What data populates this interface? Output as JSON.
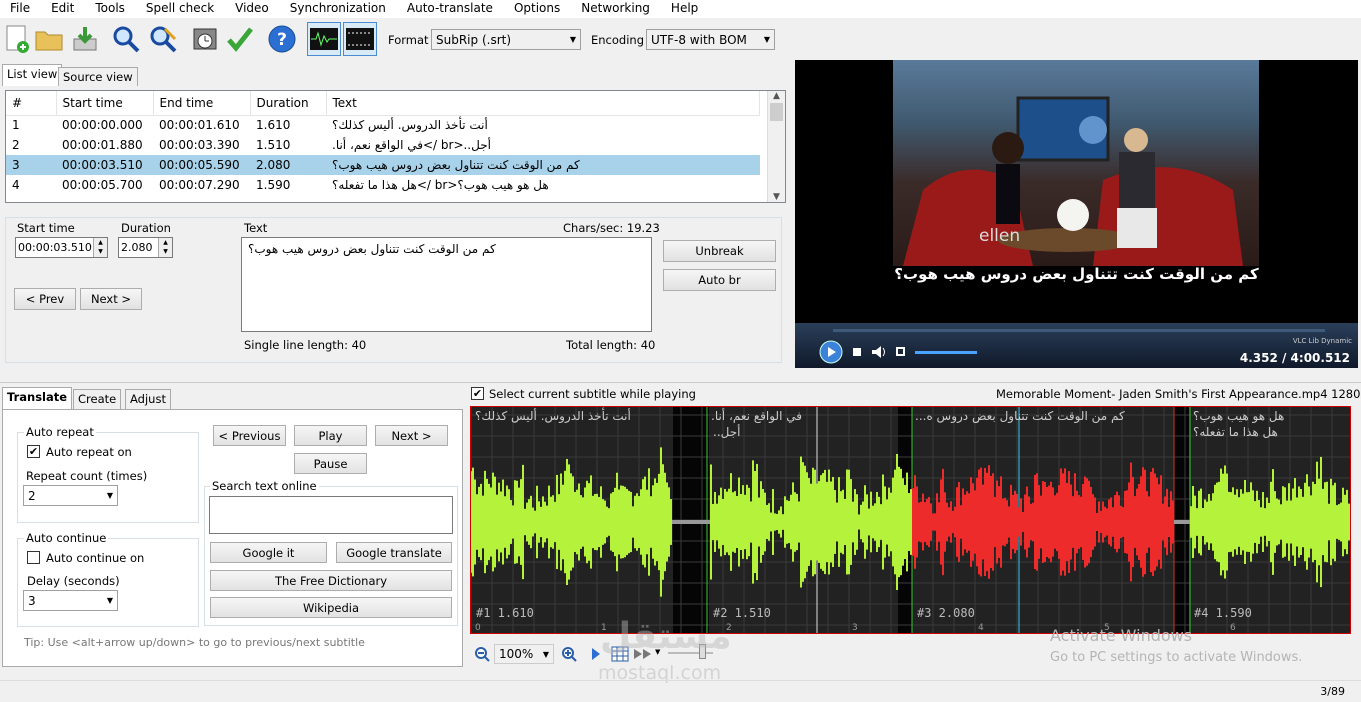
{
  "menu": [
    "File",
    "Edit",
    "Tools",
    "Spell check",
    "Video",
    "Synchronization",
    "Auto-translate",
    "Options",
    "Networking",
    "Help"
  ],
  "toolbar": {
    "format_label": "Format",
    "format_value": "SubRip (.srt)",
    "encoding_label": "Encoding",
    "encoding_value": "UTF-8 with BOM"
  },
  "tabs": {
    "list_view": "List view",
    "source_view": "Source view"
  },
  "grid": {
    "headers": [
      "#",
      "Start time",
      "End time",
      "Duration",
      "Text"
    ],
    "rows": [
      {
        "n": "1",
        "start": "00:00:00.000",
        "end": "00:00:01.610",
        "dur": "1.610",
        "text": "أنت تأخذ الدروس. أليس كذلك؟"
      },
      {
        "n": "2",
        "start": "00:00:01.880",
        "end": "00:00:03.390",
        "dur": "1.510",
        "text": "أجل..<br />في الواقع نعم، أنا."
      },
      {
        "n": "3",
        "start": "00:00:03.510",
        "end": "00:00:05.590",
        "dur": "2.080",
        "text": "كم من الوقت كنت تتناول بعض دروس هيب هوب؟"
      },
      {
        "n": "4",
        "start": "00:00:05.700",
        "end": "00:00:07.290",
        "dur": "1.590",
        "text": "هل هو هيب هوب؟<br />هل هذا ما تفعله؟"
      }
    ]
  },
  "editor": {
    "start_time_label": "Start time",
    "start_time": "00:00:03.510",
    "duration_label": "Duration",
    "duration": "2.080",
    "text_label": "Text",
    "chars_sec": "Chars/sec: 19.23",
    "text": "كم من الوقت كنت تتناول بعض دروس هيب هوب؟",
    "prev": "< Prev",
    "next": "Next >",
    "unbreak": "Unbreak",
    "auto_br": "Auto br",
    "single_line": "Single line length: 40",
    "total_length": "Total length: 40"
  },
  "video": {
    "subtitle": "كم من الوقت كنت تتناول بعض دروس هيب هوب؟",
    "badge": "VLC Lib Dynamic",
    "time": "4.352 / 4:00.512",
    "logo": "ellen"
  },
  "bottom_tabs": [
    "Translate",
    "Create",
    "Adjust"
  ],
  "translate": {
    "auto_repeat_title": "Auto repeat",
    "auto_repeat_on": "Auto repeat on",
    "repeat_count_label": "Repeat count (times)",
    "repeat_count": "2",
    "auto_continue_title": "Auto continue",
    "auto_continue_on": "Auto continue on",
    "delay_label": "Delay (seconds)",
    "delay": "3",
    "previous": "< Previous",
    "play": "Play",
    "next": "Next >",
    "pause": "Pause",
    "search_title": "Search text online",
    "google_it": "Google it",
    "google_translate": "Google translate",
    "free_dictionary": "The Free Dictionary",
    "wikipedia": "Wikipedia",
    "tip": "Tip: Use <alt+arrow up/down> to go to previous/next subtitle"
  },
  "waveform": {
    "select_label": "Select current subtitle while playing",
    "file_info": "Memorable Moment- Jaden Smith's First Appearance.mp4 1280x720",
    "segments": [
      {
        "label": "#1  1.610",
        "text": "أنت تأخذ الدروس. أليس كذلك؟",
        "text2": ""
      },
      {
        "label": "#2  1.510",
        "text": "في الواقع نعم، أنا.",
        "text2": "أجل.."
      },
      {
        "label": "#3  2.080",
        "text": "كم من الوقت كنت تتناول بعض دروس ه...",
        "text2": ""
      },
      {
        "label": "#4  1.590",
        "text": "هل هو هيب هوب؟",
        "text2": "هل هذا ما تفعله؟"
      }
    ],
    "ticks": [
      "0",
      "1",
      "2",
      "3",
      "4",
      "5",
      "6"
    ],
    "zoom": "100%"
  },
  "watermark": {
    "arabic": "مستقل",
    "latin": "mostaql.com",
    "activate": "Activate Windows",
    "activate_sub": "Go to PC settings to activate Windows."
  },
  "status": {
    "position": "3/89"
  },
  "colors": {
    "selection": "#a8d2e9",
    "wave_green": "#b5f23c",
    "wave_red": "#ee2b2b"
  }
}
